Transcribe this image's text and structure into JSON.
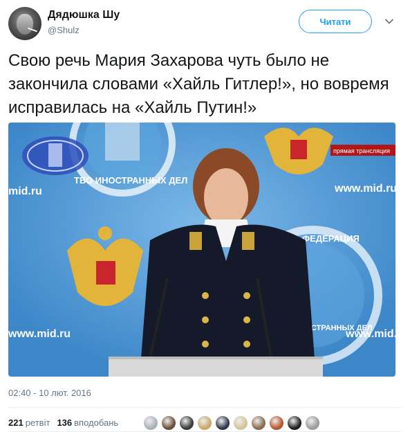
{
  "author": {
    "display_name": "Дядюшка Шу",
    "username": "@Shulz",
    "avatar_icon": "user-avatar"
  },
  "follow_button": {
    "label": "Читати"
  },
  "menu": {
    "icon": "chevron-down-icon"
  },
  "tweet": {
    "text": "Свою речь Мария Захарова чуть было не закончила словами «Хайль Гитлер!», но вовремя исправилась на «Хайль Путин!»"
  },
  "media": {
    "watermark_left": "www.mid.ru",
    "watermark_right": "www.mid.ru",
    "watermark_top_left": "mid.ru",
    "live_badge": "прямая трансляция",
    "seal_text_1": "ТВО ИНОСТРАННЫХ ДЕЛ",
    "seal_text_2": "ФЕДЕРАЦИЯ",
    "seal_text_3": "ИСТРАННЫХ ДЕЛ"
  },
  "timestamp": "02:40 - 10 лют. 2016",
  "stats": {
    "retweets_count": "221",
    "retweets_label": "ретвіт",
    "likes_count": "136",
    "likes_label": "вподобань"
  },
  "likers": [
    {
      "color": "#a9b1b8"
    },
    {
      "color": "#6b4f3a"
    },
    {
      "color": "#3b3b3b"
    },
    {
      "color": "#c9a86b"
    },
    {
      "color": "#2e3a4a"
    },
    {
      "color": "#d4c39a"
    },
    {
      "color": "#8a6d4f"
    },
    {
      "color": "#b8562f"
    },
    {
      "color": "#1f1f1f"
    },
    {
      "color": "#9c9c9c"
    }
  ],
  "colors": {
    "accent": "#1da1f2",
    "text": "#14171a",
    "secondary": "#657786",
    "divider": "#e6ecf0"
  }
}
